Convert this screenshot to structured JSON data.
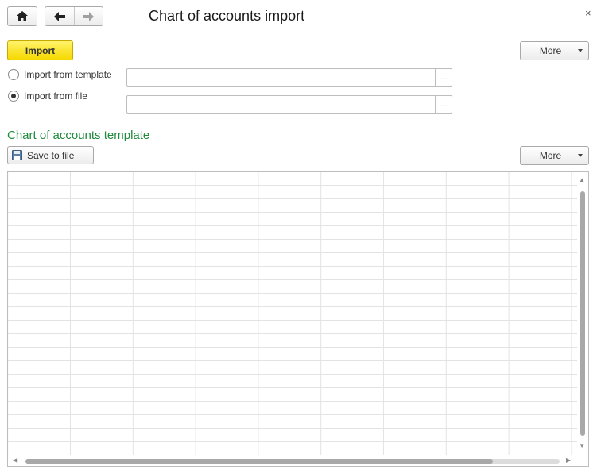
{
  "window": {
    "title": "Chart of accounts import",
    "close_glyph": "×"
  },
  "nav": {
    "home_icon": "home-icon",
    "back_icon": "arrow-left-icon",
    "forward_icon": "arrow-right-icon"
  },
  "toolbar": {
    "import_label": "Import",
    "more_label": "More"
  },
  "source": {
    "options": [
      {
        "label": "Import from template",
        "selected": false,
        "field_value": "",
        "picker_label": "..."
      },
      {
        "label": "Import from file",
        "selected": true,
        "field_value": "",
        "picker_label": "..."
      }
    ]
  },
  "template_section": {
    "title": "Chart of accounts template",
    "save_label": "Save to file",
    "save_icon": "floppy-disk-icon",
    "more_label": "More"
  },
  "colors": {
    "accent_green": "#1e8a3c",
    "import_yellow": "#f6d800"
  }
}
